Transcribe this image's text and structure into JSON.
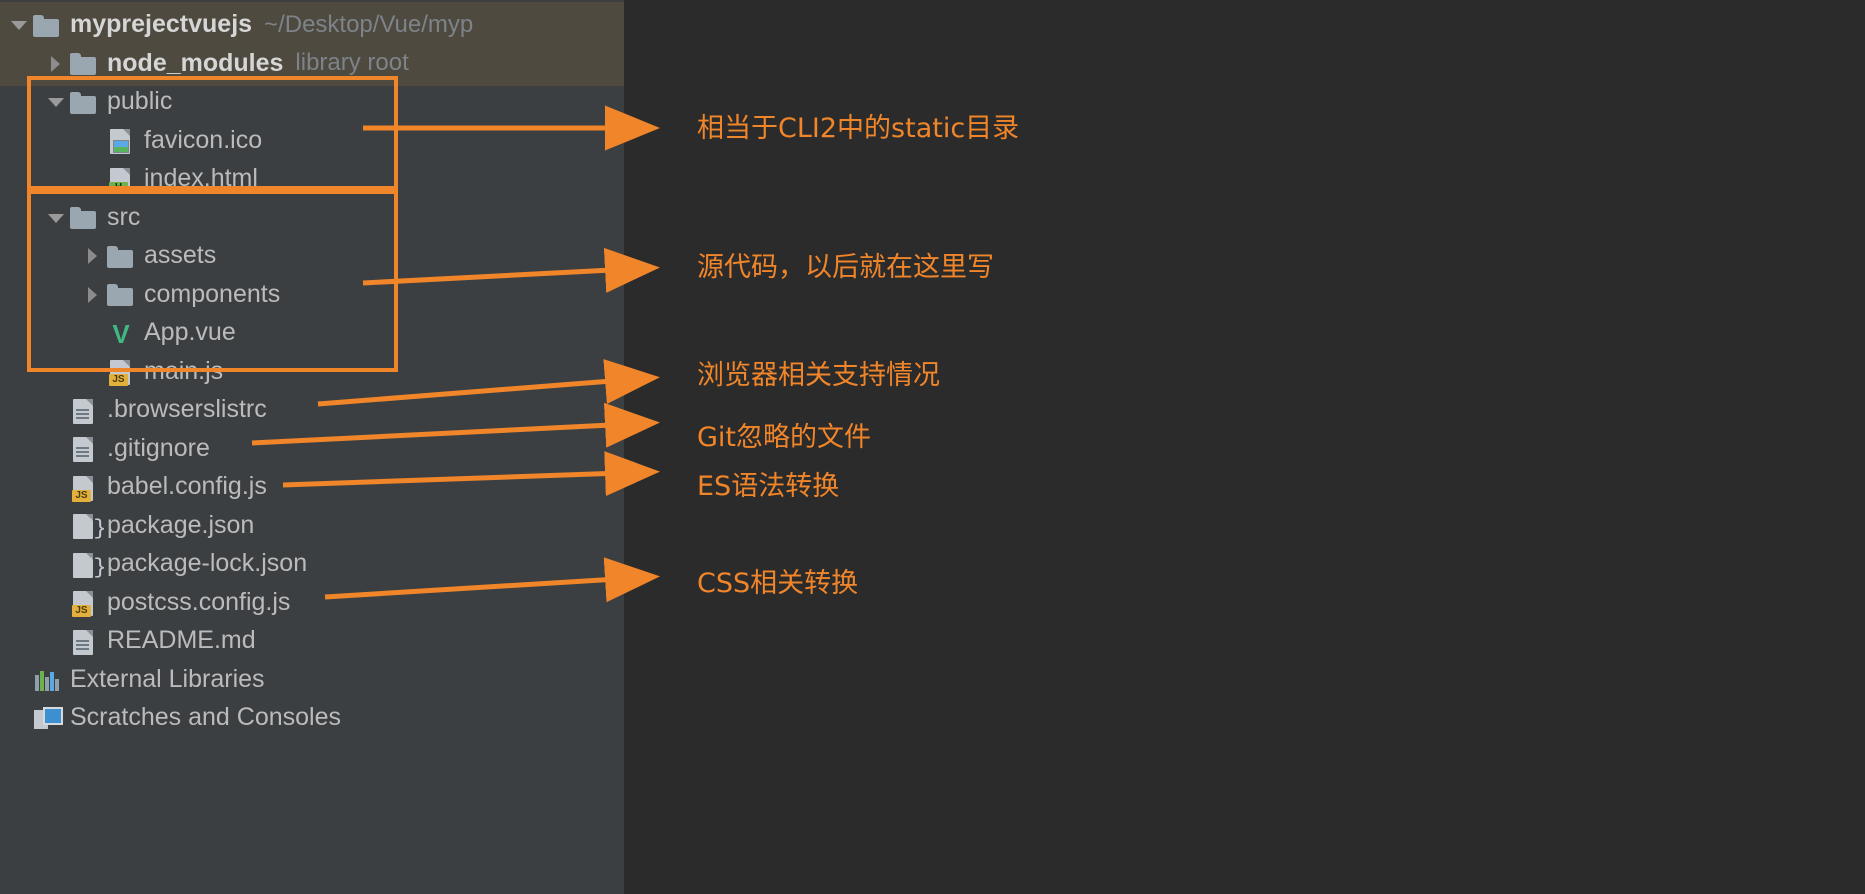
{
  "window": {
    "background": "#2b2b2b",
    "panel_background": "#3c3f41",
    "accent": "#f0852a",
    "text_color": "#bbbbbb"
  },
  "tree": {
    "items": [
      {
        "label": "myprejectvuejs",
        "hint": "~/Desktop/Vue/myp",
        "icon": "folder-icon",
        "toggle": "down",
        "depth": 0,
        "bold": true,
        "selected": true
      },
      {
        "label": "node_modules",
        "hint": "library root",
        "icon": "folder-icon",
        "toggle": "right",
        "depth": 1,
        "bold": true,
        "selected": true
      },
      {
        "label": "public",
        "hint": "",
        "icon": "folder-icon",
        "toggle": "down",
        "depth": 1,
        "bold": false,
        "selected": false
      },
      {
        "label": "favicon.ico",
        "hint": "",
        "icon": "image-file-icon",
        "toggle": "none",
        "depth": 2,
        "bold": false,
        "selected": false
      },
      {
        "label": "index.html",
        "hint": "",
        "icon": "html-file-icon",
        "toggle": "none",
        "depth": 2,
        "bold": false,
        "selected": false
      },
      {
        "label": "src",
        "hint": "",
        "icon": "folder-icon",
        "toggle": "down",
        "depth": 1,
        "bold": false,
        "selected": false
      },
      {
        "label": "assets",
        "hint": "",
        "icon": "folder-icon",
        "toggle": "right",
        "depth": 2,
        "bold": false,
        "selected": false
      },
      {
        "label": "components",
        "hint": "",
        "icon": "folder-icon",
        "toggle": "right",
        "depth": 2,
        "bold": false,
        "selected": false
      },
      {
        "label": "App.vue",
        "hint": "",
        "icon": "vue-file-icon",
        "toggle": "none",
        "depth": 2,
        "bold": false,
        "selected": false
      },
      {
        "label": "main.js",
        "hint": "",
        "icon": "js-file-icon",
        "toggle": "none",
        "depth": 2,
        "bold": false,
        "selected": false
      },
      {
        "label": ".browserslistrc",
        "hint": "",
        "icon": "text-file-icon",
        "toggle": "none",
        "depth": 1,
        "bold": false,
        "selected": false
      },
      {
        "label": ".gitignore",
        "hint": "",
        "icon": "text-file-icon",
        "toggle": "none",
        "depth": 1,
        "bold": false,
        "selected": false
      },
      {
        "label": "babel.config.js",
        "hint": "",
        "icon": "js-file-icon",
        "toggle": "none",
        "depth": 1,
        "bold": false,
        "selected": false
      },
      {
        "label": "package.json",
        "hint": "",
        "icon": "json-file-icon",
        "toggle": "none",
        "depth": 1,
        "bold": false,
        "selected": false
      },
      {
        "label": "package-lock.json",
        "hint": "",
        "icon": "json-file-icon",
        "toggle": "none",
        "depth": 1,
        "bold": false,
        "selected": false
      },
      {
        "label": "postcss.config.js",
        "hint": "",
        "icon": "js-file-icon",
        "toggle": "none",
        "depth": 1,
        "bold": false,
        "selected": false
      },
      {
        "label": "README.md",
        "hint": "",
        "icon": "text-file-icon",
        "toggle": "none",
        "depth": 1,
        "bold": false,
        "selected": false
      },
      {
        "label": "External Libraries",
        "hint": "",
        "icon": "libraries-icon",
        "toggle": "none",
        "depth": 0,
        "bold": false,
        "selected": false
      },
      {
        "label": "Scratches and Consoles",
        "hint": "",
        "icon": "scratches-icon",
        "toggle": "none",
        "depth": 0,
        "bold": false,
        "selected": false
      }
    ]
  },
  "annotations": [
    {
      "text": "相当于CLI2中的static目录"
    },
    {
      "text": "源代码，以后就在这里写"
    },
    {
      "text": "浏览器相关支持情况"
    },
    {
      "text": "Git忽略的文件"
    },
    {
      "text": "ES语法转换"
    },
    {
      "text": "CSS相关转换"
    }
  ],
  "highlight_boxes": [
    {
      "name": "public-folder-highlight"
    },
    {
      "name": "src-folder-highlight"
    }
  ]
}
